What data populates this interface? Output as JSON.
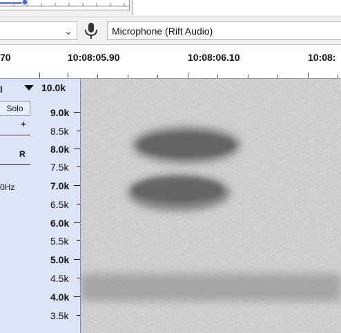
{
  "device_toolbar": {
    "input_device": "Microphone (Rift Audio)"
  },
  "timeline": {
    "labels": [
      "70",
      "10:08:05.90",
      "10:08:06.10",
      "10:08:"
    ]
  },
  "track_panel": {
    "name": "l",
    "solo_label": "Solo",
    "gain_plus": "+",
    "pan_right": "R",
    "rate": "0Hz"
  },
  "frequency_axis": {
    "labels": [
      "10.0k",
      "9.0k",
      "8.5k",
      "8.0k",
      "7.5k",
      "7.0k",
      "6.5k",
      "6.0k",
      "5.5k",
      "5.0k",
      "4.5k",
      "4.0k",
      "3.5k"
    ],
    "bold": [
      true,
      true,
      false,
      true,
      false,
      true,
      false,
      true,
      false,
      true,
      false,
      true,
      false
    ]
  },
  "colors": {
    "track_panel_bg": "#dbe5f7",
    "meter_knob": "#3f5fbf",
    "spectrogram_bg": "#c4c4c4"
  },
  "icons": [
    "chevron-down-icon",
    "microphone-icon",
    "dropdown-arrow-icon"
  ]
}
